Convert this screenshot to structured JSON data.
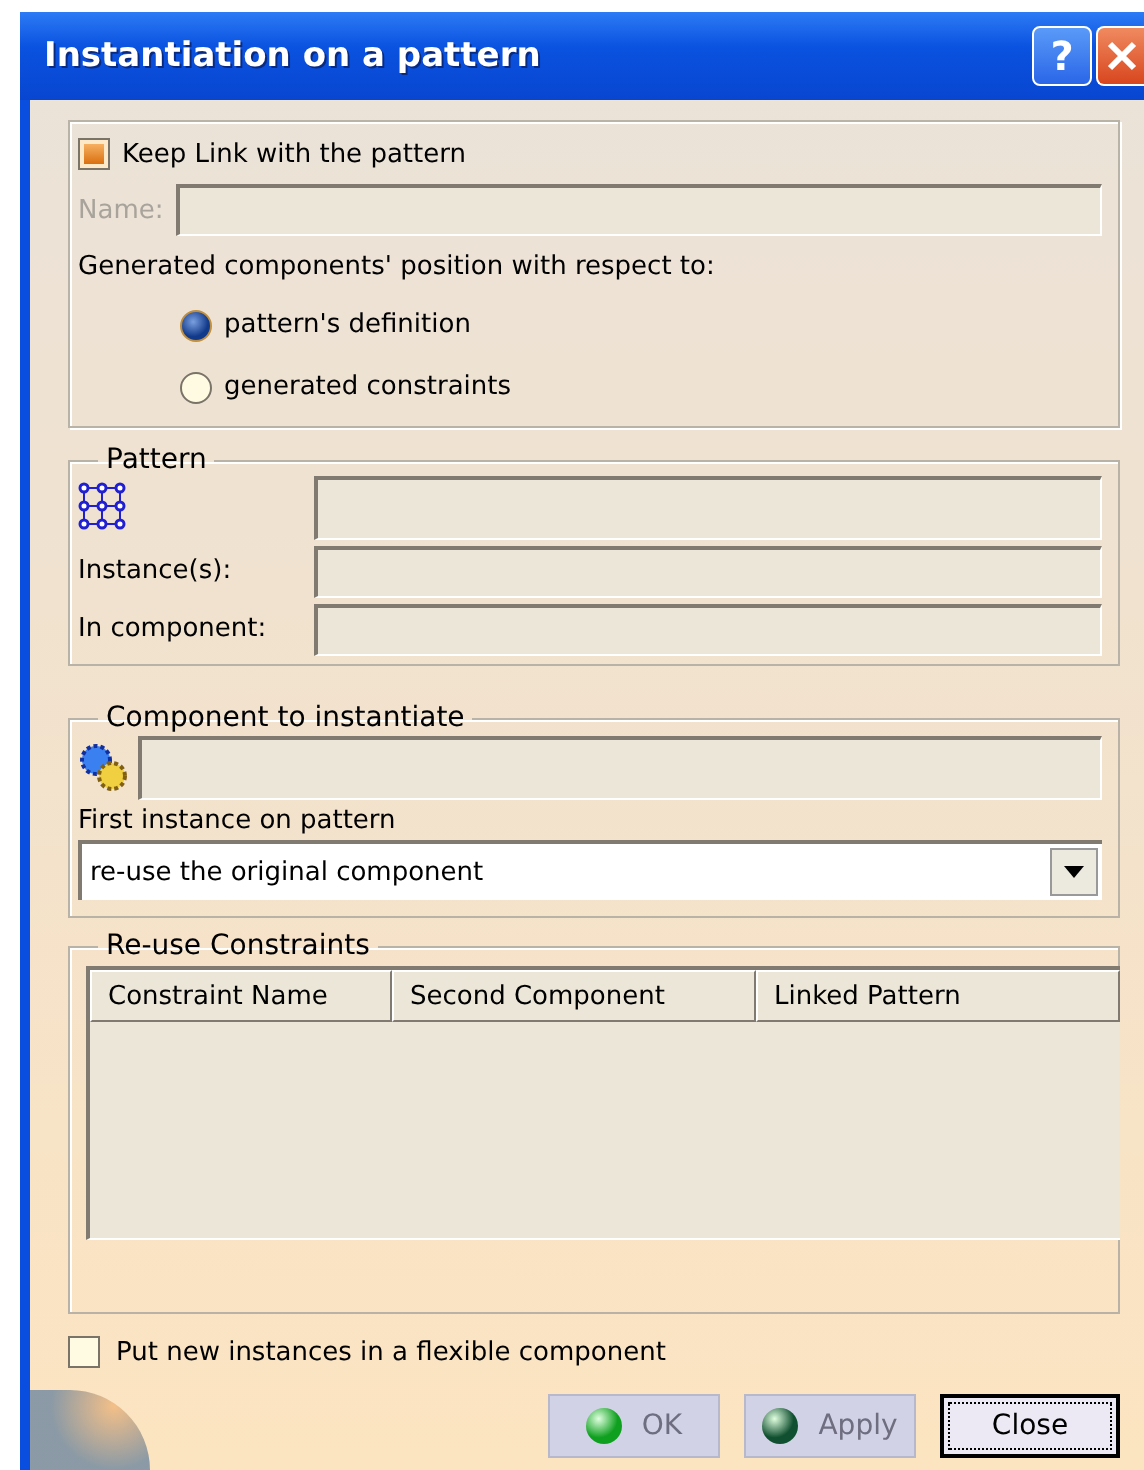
{
  "window": {
    "title": "Instantiation on a pattern",
    "help": "?"
  },
  "link": {
    "label": "Keep Link with the pattern",
    "checked": true
  },
  "name_field": {
    "label": "Name:",
    "disabled": true
  },
  "position": {
    "label": "Generated components' position with respect to:",
    "options": [
      {
        "label": "pattern's definition",
        "selected": true
      },
      {
        "label": "generated constraints",
        "selected": false
      }
    ]
  },
  "pattern": {
    "title": "Pattern",
    "rows": [
      {
        "kind": "icon"
      },
      {
        "kind": "label",
        "label": "Instance(s):"
      },
      {
        "kind": "label",
        "label": "In component:"
      }
    ]
  },
  "component": {
    "title": "Component to instantiate",
    "first_instance_label": "First instance on pattern",
    "dropdown": {
      "value": "re-use the original component"
    }
  },
  "constraints": {
    "title": "Re-use Constraints",
    "columns": [
      "Constraint Name",
      "Second Component",
      "Linked Pattern"
    ]
  },
  "flexible": {
    "label": "Put new instances in a flexible component",
    "checked": false
  },
  "buttons": [
    {
      "label": "OK",
      "disabled": true,
      "kind": "ok",
      "focused": false
    },
    {
      "label": "Apply",
      "disabled": true,
      "kind": "apply",
      "focused": false
    },
    {
      "label": "Close",
      "disabled": false,
      "kind": "plain",
      "focused": true
    }
  ]
}
